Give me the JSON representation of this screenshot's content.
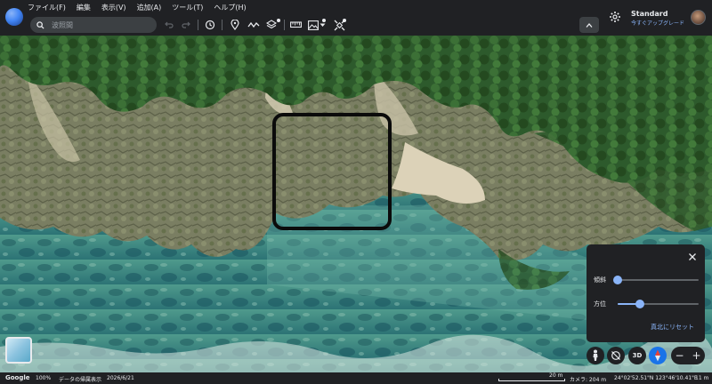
{
  "menu": [
    "ファイル(F)",
    "編集",
    "表示(V)",
    "追加(A)",
    "ツール(T)",
    "ヘルプ(H)"
  ],
  "search": {
    "placeholder": "波照間"
  },
  "toolbar": {
    "icons": [
      "undo-icon",
      "redo-icon",
      "history-icon",
      "placemark-icon",
      "path-icon",
      "layers-icon",
      "ruler-icon",
      "image-overlay-icon",
      "satellite-icon",
      "collapse-icon"
    ]
  },
  "account": {
    "plan": "Standard",
    "upgrade": "今すぐアップグレード"
  },
  "panel": {
    "tilt_label": "傾斜",
    "tilt_value": 0.0,
    "heading_label": "方位",
    "heading_value": 0.27,
    "reset_label": "真北にリセット"
  },
  "controls": {
    "three_d": "3D",
    "zoom_out": "−",
    "zoom_in": "+"
  },
  "status": {
    "brand": "Google",
    "zoom": "100%",
    "attribution": "データの帰属表示",
    "date": "2026/6/21",
    "scale": "20 m",
    "camera": "カメラ: 204 m",
    "coords": "24°02'52.51\"N 123°46'10.41\"E",
    "elevation": "11 m"
  },
  "colors": {
    "accent": "#8ab4f8",
    "compass": "#1a73e8",
    "forest": "#2f5a2e",
    "sea": "#2f7d7a",
    "sand": "#dcd2b8",
    "cliff": "#7d8166"
  }
}
